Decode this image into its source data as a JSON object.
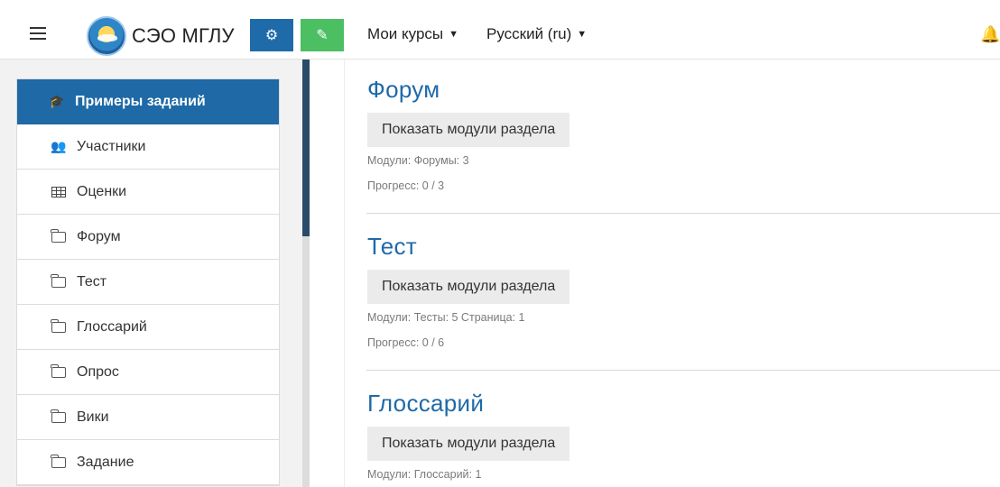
{
  "navbar": {
    "brand": "СЭО МГЛУ",
    "menu": [
      {
        "label": "Мои курсы"
      },
      {
        "label": "Русский (ru)"
      }
    ],
    "icons": {
      "menu": "hamburger-icon",
      "gear": "gears-icon",
      "edit": "edit-icon",
      "bell": "bell-icon"
    },
    "colors": {
      "gear_button": "#1f6aa8",
      "edit_button": "#4cbf63"
    }
  },
  "drawer": {
    "items": [
      {
        "label": "Примеры заданий",
        "icon": "graduation-cap-icon",
        "active": true
      },
      {
        "label": "Участники",
        "icon": "users-icon"
      },
      {
        "label": "Оценки",
        "icon": "table-icon"
      },
      {
        "label": "Форум",
        "icon": "folder-icon"
      },
      {
        "label": "Тест",
        "icon": "folder-icon"
      },
      {
        "label": "Глоссарий",
        "icon": "folder-icon"
      },
      {
        "label": "Опрос",
        "icon": "folder-icon"
      },
      {
        "label": "Вики",
        "icon": "folder-icon"
      },
      {
        "label": "Задание",
        "icon": "folder-icon"
      }
    ],
    "active_color": "#1e69a6"
  },
  "sections": [
    {
      "title": "Форум",
      "button": "Показать модули раздела",
      "modules": "Модули:  Форумы: 3",
      "progress": "Прогресс: 0 / 3"
    },
    {
      "title": "Тест",
      "button": "Показать модули раздела",
      "modules": "Модули:  Тесты: 5  Страница: 1",
      "progress": "Прогресс: 0 / 6"
    },
    {
      "title": "Глоссарий",
      "button": "Показать модули раздела",
      "modules": "Модули:  Глоссарий: 1"
    }
  ],
  "theme": {
    "title_color": "#1f6aa8"
  }
}
